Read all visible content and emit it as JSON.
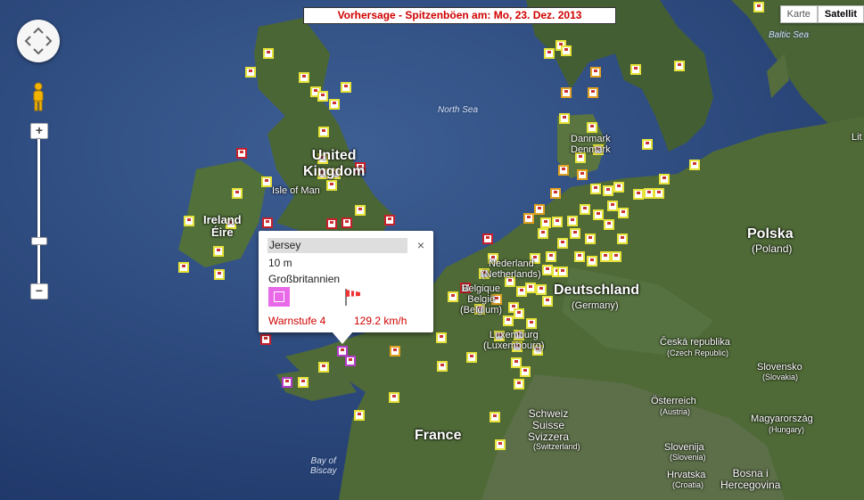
{
  "title": "Vorhersage - Spitzenböen am: Mo, 23. Dez. 2013",
  "map_type": {
    "karte": "Karte",
    "satellit": "Satellit",
    "active": "satellit"
  },
  "labels": {
    "uk": "United\nKingdom",
    "isle_of_man": "Isle of Man",
    "ireland": "Ireland\nÉire",
    "north_sea": "North Sea",
    "baltic_sea": "Baltic Sea",
    "danmark": "Danmark\nDenmark",
    "nederland": "Nederland\n(Netherlands)",
    "belgique": "Belgique\nBelgië\n(Belgium)",
    "luxembourg": "Luxemburg\n(Luxembourg)",
    "deutschland": "Deutschland",
    "germany": "(Germany)",
    "polska": "Polska",
    "poland": "(Poland)",
    "cesko": "Česká republika",
    "czech": "(Czech Republic)",
    "slovensko": "Slovensko",
    "slovakia": "(Slovakia)",
    "oesterreich": "Österreich",
    "austria": "(Austria)",
    "magyar": "Magyarország",
    "hungary": "(Hungary)",
    "schweiz": "Schweiz\nSuisse\nSvizzera",
    "switzerland": "(Switzerland)",
    "slovenija": "Slovenija",
    "slovenia": "(Slovenia)",
    "hrvatska": "Hrvatska",
    "croatia": "(Croatia)",
    "bosnia": "Bosna i\nHercegovina",
    "france": "France",
    "bay_of_biscay": "Bay of\nBiscay",
    "lit": "Lit"
  },
  "popup": {
    "name": "Jersey",
    "height": "10 m",
    "country": "Großbritannien",
    "warn": "Warnstufe 4",
    "speed": "129.2  km/h",
    "close": "×"
  },
  "colors": {
    "sea": "#2c4a7c",
    "land": "#4f6a37",
    "title_text": "#d00000",
    "marker_yellow": "#e6e23a",
    "marker_orange": "#e0a020",
    "marker_red": "#c8202a",
    "marker_purple": "#b43cc8"
  },
  "zoom": {
    "plus": "+",
    "minus": "−"
  }
}
